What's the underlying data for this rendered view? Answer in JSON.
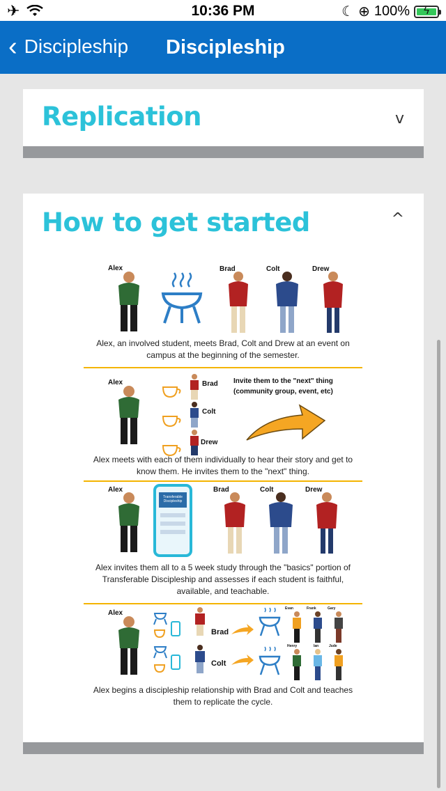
{
  "status": {
    "time": "10:36 PM",
    "battery": "100%"
  },
  "nav": {
    "back_label": "Discipleship",
    "title": "Discipleship"
  },
  "sections": [
    {
      "title": "Replication",
      "chevron": "v"
    },
    {
      "title": "How to get started",
      "chevron": "^"
    }
  ],
  "infographic": {
    "names": {
      "alex": "Alex",
      "brad": "Brad",
      "colt": "Colt",
      "drew": "Drew",
      "evan": "Evan",
      "frank": "Frank",
      "gary": "Gary",
      "henry": "Henry",
      "ian": "Ian",
      "jude": "Jude"
    },
    "invite_note": "Invite them to the \"next\" thing (community group, event, etc)",
    "phone_title": "Transferable Discipleship",
    "captions": [
      "Alex, an involved student, meets Brad, Colt and Drew at an event on campus at the beginning of the semester.",
      "Alex meets with each of them individually to hear their story and get to know them. He invites them to the \"next\" thing.",
      "Alex invites them all to a 5 week study through the \"basics\" portion of Transferable Discipleship and assesses if each student is faithful, available, and teachable.",
      "Alex begins a discipleship relationship with Brad and Colt and teaches them to replicate the cycle."
    ]
  }
}
